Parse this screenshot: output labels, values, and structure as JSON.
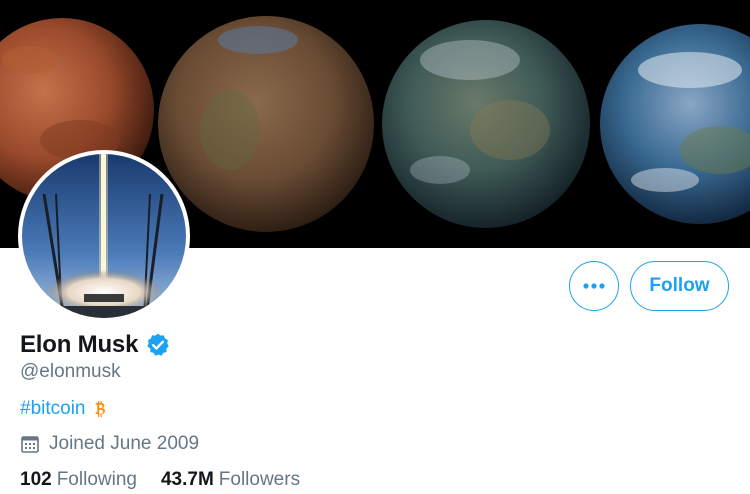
{
  "profile": {
    "display_name": "Elon Musk",
    "handle": "@elonmusk",
    "bio_hashtag": "#bitcoin",
    "joined": "Joined June 2009",
    "following_count": "102",
    "following_label": "Following",
    "followers_count": "43.7M",
    "followers_label": "Followers"
  },
  "actions": {
    "follow_label": "Follow",
    "more_label": "•••"
  },
  "icons": {
    "verified": "verified-badge-icon",
    "bitcoin": "bitcoin-icon",
    "calendar": "calendar-icon",
    "more": "more-icon"
  },
  "colors": {
    "accent": "#1da1f2",
    "text_primary": "#14171a",
    "text_secondary": "#657786",
    "bitcoin": "#f7931a"
  }
}
